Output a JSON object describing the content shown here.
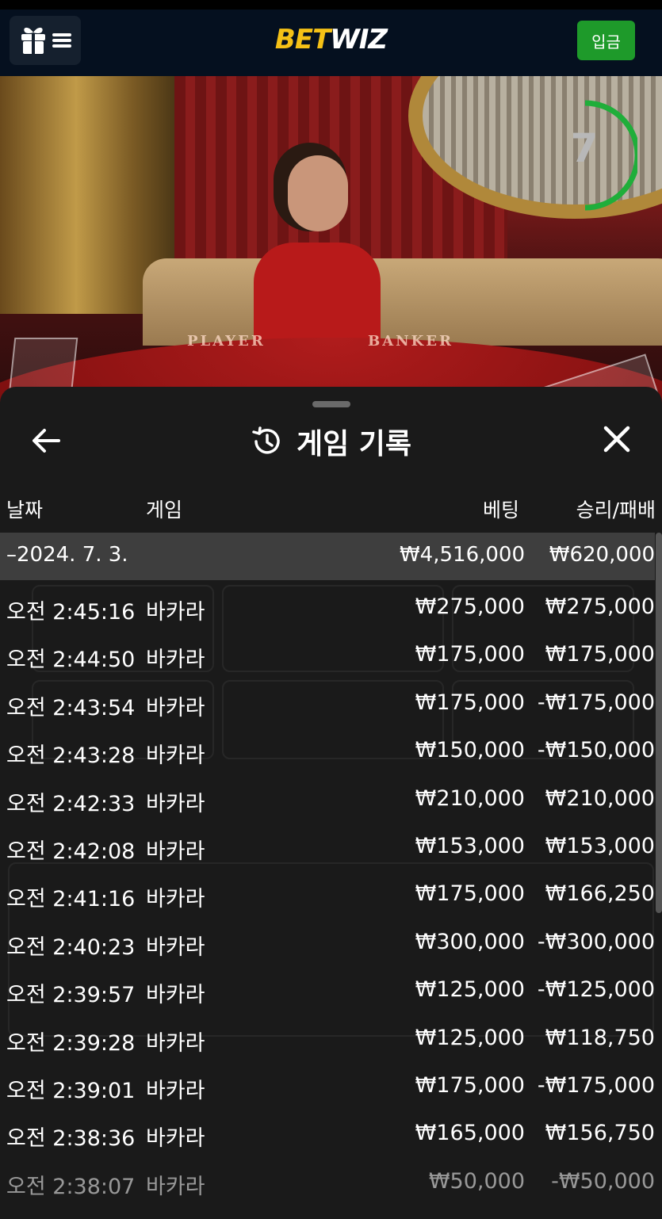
{
  "header": {
    "logo_part1": "BET",
    "logo_part2": "WIZ",
    "deposit_label": "입금",
    "icons": [
      "gift-icon",
      "menu-icon"
    ]
  },
  "scene": {
    "table_labels": [
      "PLAYER",
      "BANKER"
    ],
    "timer_value": "7",
    "timer_color": "#1fae3a"
  },
  "panel": {
    "title": "게임 기록",
    "icons": [
      "back-arrow-icon",
      "history-icon",
      "close-icon"
    ],
    "columns": {
      "date": "날짜",
      "game": "게임",
      "bet": "베팅",
      "result": "승리/패배"
    },
    "date_group": {
      "label": "–2024. 7. 3.",
      "bet_total": "₩4,516,000",
      "result_total": "₩620,000"
    },
    "rows": [
      {
        "time": "오전 2:45:16",
        "game": "바카라",
        "bet": "₩275,000",
        "result": "₩275,000"
      },
      {
        "time": "오전 2:44:50",
        "game": "바카라",
        "bet": "₩175,000",
        "result": "₩175,000"
      },
      {
        "time": "오전 2:43:54",
        "game": "바카라",
        "bet": "₩175,000",
        "result": "-₩175,000"
      },
      {
        "time": "오전 2:43:28",
        "game": "바카라",
        "bet": "₩150,000",
        "result": "-₩150,000"
      },
      {
        "time": "오전 2:42:33",
        "game": "바카라",
        "bet": "₩210,000",
        "result": "₩210,000"
      },
      {
        "time": "오전 2:42:08",
        "game": "바카라",
        "bet": "₩153,000",
        "result": "₩153,000"
      },
      {
        "time": "오전 2:41:16",
        "game": "바카라",
        "bet": "₩175,000",
        "result": "₩166,250"
      },
      {
        "time": "오전 2:40:23",
        "game": "바카라",
        "bet": "₩300,000",
        "result": "-₩300,000"
      },
      {
        "time": "오전 2:39:57",
        "game": "바카라",
        "bet": "₩125,000",
        "result": "-₩125,000"
      },
      {
        "time": "오전 2:39:28",
        "game": "바카라",
        "bet": "₩125,000",
        "result": "₩118,750"
      },
      {
        "time": "오전 2:39:01",
        "game": "바카라",
        "bet": "₩175,000",
        "result": "-₩175,000"
      },
      {
        "time": "오전 2:38:36",
        "game": "바카라",
        "bet": "₩165,000",
        "result": "₩156,750"
      },
      {
        "time": "오전 2:38:07",
        "game": "바카라",
        "bet": "₩50,000",
        "result": "-₩50,000"
      }
    ]
  }
}
